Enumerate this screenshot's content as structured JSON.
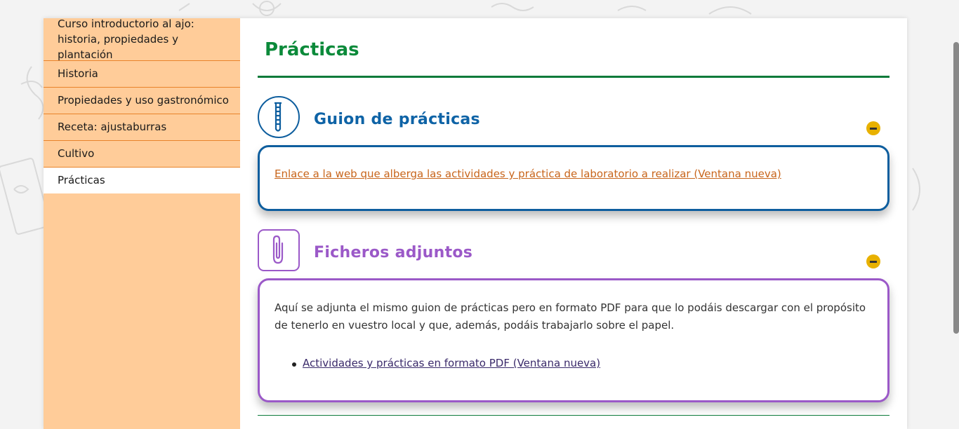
{
  "sidebar": {
    "items": [
      {
        "label": "Curso introductorio al ajo: historia, propiedades y plantación"
      },
      {
        "label": "Historia"
      },
      {
        "label": "Propiedades y uso gastronómico"
      },
      {
        "label": "Receta: ajustaburras"
      },
      {
        "label": "Cultivo"
      },
      {
        "label": "Prácticas"
      }
    ]
  },
  "main": {
    "title": "Prácticas",
    "sections": [
      {
        "heading": "Guion de prácticas",
        "icon": "test-tube-icon",
        "color": "#0e5e9e",
        "link": "Enlace a la web que alberga las actividades y práctica de laboratorio a realizar (Ventana nueva)"
      },
      {
        "heading": "Ficheros adjuntos",
        "icon": "paperclip-icon",
        "color": "#9b59c8",
        "text": "Aquí se adjunta el mismo guion de prácticas pero en formato PDF para que lo podáis descargar con el propósito de tenerlo en vuestro local y que, además, podáis trabajarlo sobre el papel.",
        "links": [
          "Actividades y prácticas en formato PDF (Ventana nueva)"
        ]
      }
    ]
  },
  "colors": {
    "sidebar_bg": "#ffcc99",
    "title_green": "#0b8a3a",
    "toggle_yellow": "#e8b100"
  }
}
